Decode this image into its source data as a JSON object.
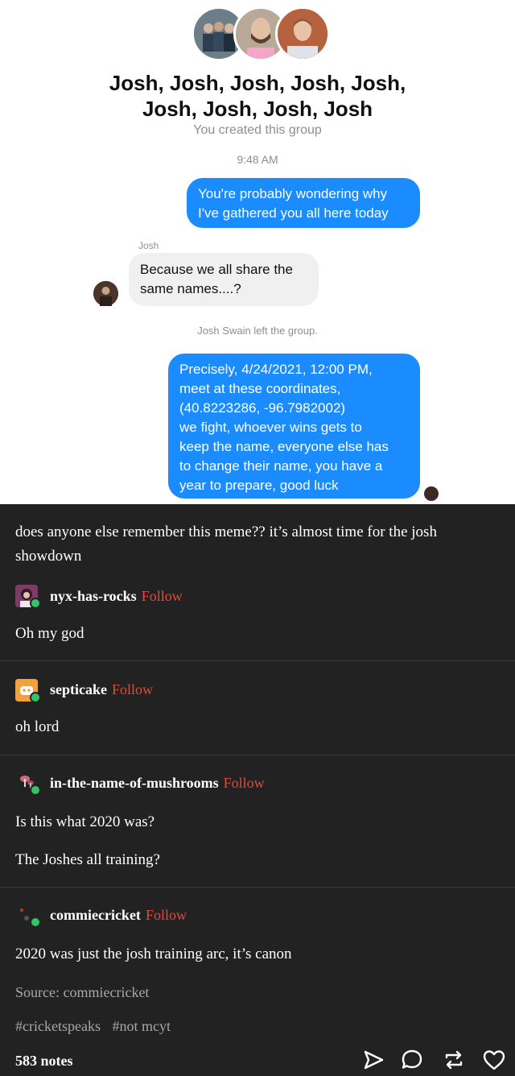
{
  "messenger": {
    "group_title": "Josh, Josh, Josh, Josh, Josh, Josh, Josh, Josh, Josh",
    "group_title_line1": "Josh, Josh, Josh, Josh, Josh,",
    "group_title_line2": "Josh, Josh, Josh, Josh",
    "created_note": "You created this group",
    "timestamp": "9:48 AM",
    "messages": [
      {
        "direction": "outgoing",
        "lines": [
          "You're probably wondering why",
          "I've gathered you all here today"
        ]
      },
      {
        "direction": "incoming",
        "sender": "Josh",
        "lines": [
          "Because we all share the",
          "same names....?"
        ]
      },
      {
        "direction": "outgoing",
        "lines": [
          "Precisely, 4/24/2021, 12:00 PM,",
          "meet at these coordinates,",
          "(40.8223286, -96.7982002)",
          "we fight, whoever wins gets to",
          "keep the name, everyone else has",
          "to change their name, you have a",
          "year to prepare, good luck"
        ]
      }
    ],
    "left_note": "Josh Swain left the group."
  },
  "post": {
    "caption": "does anyone else remember this meme?? it’s almost time for the josh showdown",
    "reblogs": [
      {
        "username": "nyx-has-rocks",
        "follow_label": "Follow",
        "text": [
          "Oh my god"
        ]
      },
      {
        "username": "septicake",
        "follow_label": "Follow",
        "text": [
          "oh lord"
        ]
      },
      {
        "username": "in-the-name-of-mushrooms",
        "follow_label": "Follow",
        "text": [
          "Is this what 2020 was?",
          "The Joshes all training?"
        ]
      },
      {
        "username": "commiecricket",
        "follow_label": "Follow",
        "text": [
          "2020 was just the josh training arc, it’s canon"
        ]
      }
    ],
    "source": "Source: commiecricket",
    "tags": [
      "#cricketspeaks",
      "#not mcyt"
    ],
    "notes": "583 notes",
    "actions": [
      "send-icon",
      "comment-icon",
      "reblog-icon",
      "heart-icon"
    ]
  },
  "colors": {
    "post_background": "#222222",
    "follow_link": "#e14b3b",
    "messenger_blue": "#1a8cff",
    "reblog_badge": "#33c466"
  }
}
